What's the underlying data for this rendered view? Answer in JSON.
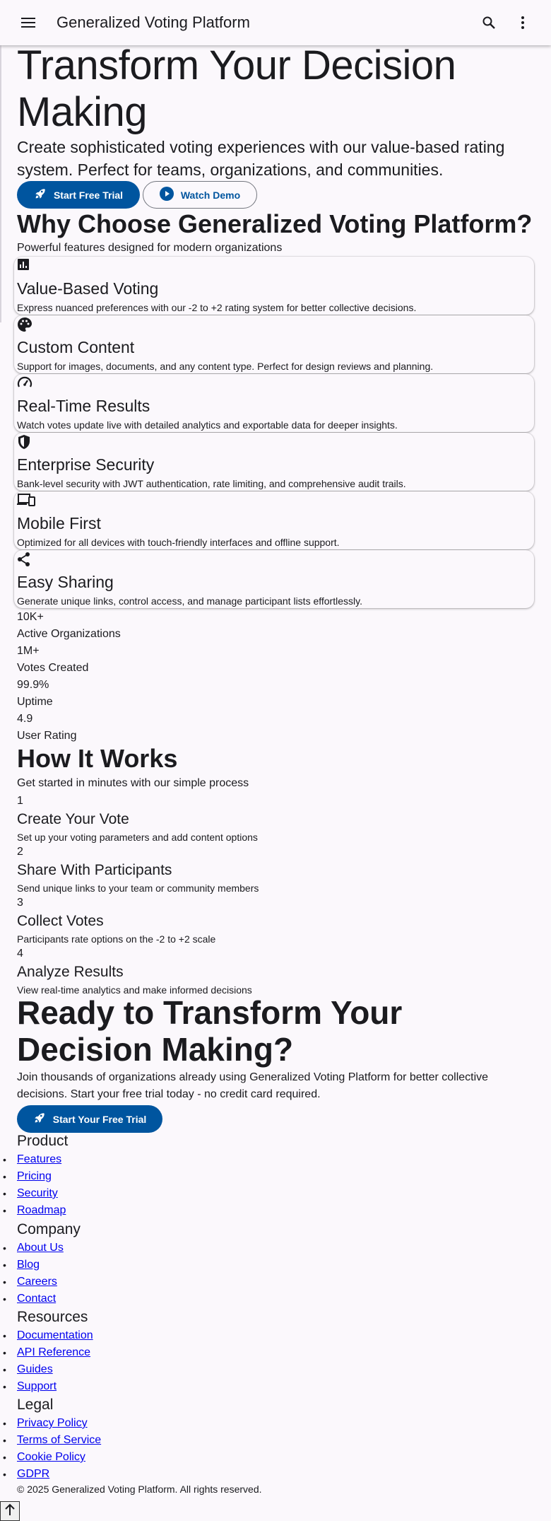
{
  "appbar": {
    "title": "Generalized Voting Platform",
    "menu_icon": "menu-icon",
    "search_icon": "search-icon",
    "more_icon": "more-vert-icon"
  },
  "hero": {
    "title": "Transform Your Decision Making",
    "subtitle": "Create sophisticated voting experiences with our value-based rating system. Perfect for teams, organizations, and communities.",
    "primary_label": "Start Free Trial",
    "primary_icon": "rocket-icon",
    "secondary_label": "Watch Demo",
    "secondary_icon": "play-circle-icon"
  },
  "features": {
    "title": "Why Choose Generalized Voting Platform?",
    "subtitle": "Powerful features designed for modern organizations",
    "items": [
      {
        "icon": "analytics-icon",
        "title": "Value-Based Voting",
        "desc": "Express nuanced preferences with our -2 to +2 rating system for better collective decisions."
      },
      {
        "icon": "palette-icon",
        "title": "Custom Content",
        "desc": "Support for images, documents, and any content type. Perfect for design reviews and planning."
      },
      {
        "icon": "speed-icon",
        "title": "Real-Time Results",
        "desc": "Watch votes update live with detailed analytics and exportable data for deeper insights."
      },
      {
        "icon": "shield-icon",
        "title": "Enterprise Security",
        "desc": "Bank-level security with JWT authentication, rate limiting, and comprehensive audit trails."
      },
      {
        "icon": "devices-icon",
        "title": "Mobile First",
        "desc": "Optimized for all devices with touch-friendly interfaces and offline support."
      },
      {
        "icon": "share-icon",
        "title": "Easy Sharing",
        "desc": "Generate unique links, control access, and manage participant lists effortlessly."
      }
    ]
  },
  "stats": [
    {
      "value": "10K+",
      "label": "Active Organizations"
    },
    {
      "value": "1M+",
      "label": "Votes Created"
    },
    {
      "value": "99.9%",
      "label": "Uptime"
    },
    {
      "value": "4.9",
      "label": "User Rating"
    }
  ],
  "how": {
    "title": "How It Works",
    "subtitle": "Get started in minutes with our simple process",
    "steps": [
      {
        "num": "1",
        "title": "Create Your Vote",
        "desc": "Set up your voting parameters and add content options"
      },
      {
        "num": "2",
        "title": "Share With Participants",
        "desc": "Send unique links to your team or community members"
      },
      {
        "num": "3",
        "title": "Collect Votes",
        "desc": "Participants rate options on the -2 to +2 scale"
      },
      {
        "num": "4",
        "title": "Analyze Results",
        "desc": "View real-time analytics and make informed decisions"
      }
    ]
  },
  "cta": {
    "title": "Ready to Transform Your Decision Making?",
    "subtitle": "Join thousands of organizations already using Generalized Voting Platform for better collective decisions. Start your free trial today - no credit card required.",
    "button_label": "Start Your Free Trial",
    "button_icon": "rocket-icon"
  },
  "footer": {
    "columns": [
      {
        "heading": "Product",
        "links": [
          "Features",
          "Pricing",
          "Security",
          "Roadmap"
        ]
      },
      {
        "heading": "Company",
        "links": [
          "About Us",
          "Blog",
          "Careers",
          "Contact"
        ]
      },
      {
        "heading": "Resources",
        "links": [
          "Documentation",
          "API Reference",
          "Guides",
          "Support"
        ]
      },
      {
        "heading": "Legal",
        "links": [
          "Privacy Policy",
          "Terms of Service",
          "Cookie Policy",
          "GDPR"
        ]
      }
    ],
    "copyright": "© 2025 Generalized Voting Platform. All rights reserved.",
    "to_top_icon": "arrow-up-icon"
  },
  "colors": {
    "primary": "#00559f",
    "background": "#fbf8fc",
    "text": "#1b1b1f",
    "link": "#0000ee"
  }
}
